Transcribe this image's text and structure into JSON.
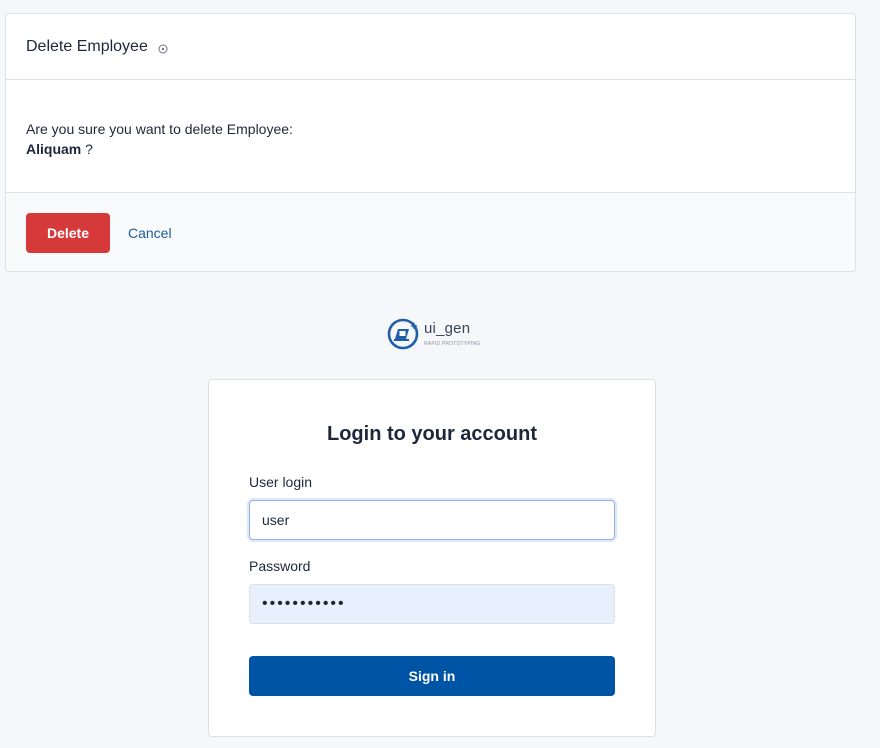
{
  "dialog": {
    "title": "Delete Employee",
    "help_icon": "help-circle-icon",
    "message": "Are you sure you want to delete Employee:",
    "employee_name": "Aliquam",
    "question_mark": " ?",
    "delete_label": "Delete",
    "cancel_label": "Cancel",
    "delete_color": "#d63939",
    "cancel_color": "#1c5d99"
  },
  "logo": {
    "name": "ui_gen",
    "tagline": "RAPID PROTOTYPING",
    "icon": "laptop-sparkle-logo-icon"
  },
  "login": {
    "title": "Login to your account",
    "user_label": "User login",
    "user_value": "user",
    "password_label": "Password",
    "password_value": "•••••••••••",
    "signin_label": "Sign in",
    "signin_color": "#0054a6"
  }
}
